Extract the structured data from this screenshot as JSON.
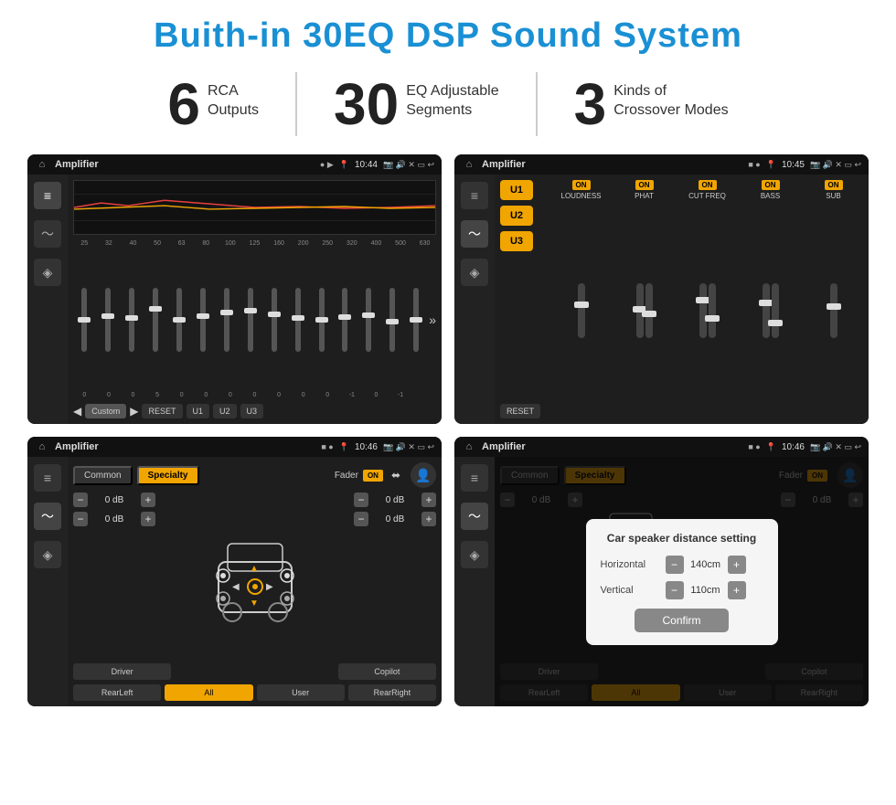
{
  "title": "Buith-in 30EQ DSP Sound System",
  "stats": [
    {
      "number": "6",
      "label": "RCA\nOutputs"
    },
    {
      "number": "30",
      "label": "EQ Adjustable\nSegments"
    },
    {
      "number": "3",
      "label": "Kinds of\nCrossover Modes"
    }
  ],
  "screen1": {
    "status_bar": {
      "home": "⌂",
      "title": "Amplifier",
      "dots": "● ▶",
      "time": "10:44"
    },
    "freq_labels": [
      "25",
      "32",
      "40",
      "50",
      "63",
      "80",
      "100",
      "125",
      "160",
      "200",
      "250",
      "320",
      "400",
      "500",
      "630"
    ],
    "slider_positions": [
      50,
      45,
      48,
      52,
      50,
      45,
      40,
      38,
      42,
      48,
      50,
      47,
      44,
      46,
      44
    ],
    "values": [
      "0",
      "0",
      "0",
      "5",
      "0",
      "0",
      "0",
      "0",
      "0",
      "0",
      "0",
      "-1",
      "0",
      "-1",
      ""
    ],
    "buttons": [
      "Custom",
      "RESET",
      "U1",
      "U2",
      "U3"
    ]
  },
  "screen2": {
    "status_bar": {
      "home": "⌂",
      "title": "Amplifier",
      "dots": "■ ●",
      "time": "10:45"
    },
    "presets": [
      "U1",
      "U2",
      "U3"
    ],
    "controls": [
      {
        "on": true,
        "label": "LOUDNESS"
      },
      {
        "on": true,
        "label": "PHAT"
      },
      {
        "on": true,
        "label": "CUT FREQ"
      },
      {
        "on": true,
        "label": "BASS"
      },
      {
        "on": true,
        "label": "SUB"
      }
    ],
    "reset_btn": "RESET"
  },
  "screen3": {
    "status_bar": {
      "home": "⌂",
      "title": "Amplifier",
      "dots": "■ ●",
      "time": "10:46"
    },
    "tabs": [
      "Common",
      "Specialty"
    ],
    "active_tab": 1,
    "fader_label": "Fader",
    "fader_on": "ON",
    "db_values": [
      "0 dB",
      "0 dB",
      "0 dB",
      "0 dB"
    ],
    "bottom_buttons": [
      "Driver",
      "",
      "Copilot",
      "RearLeft",
      "All",
      "User",
      "RearRight"
    ]
  },
  "screen4": {
    "status_bar": {
      "home": "⌂",
      "title": "Amplifier",
      "dots": "■ ●",
      "time": "10:46"
    },
    "tabs": [
      "Common",
      "Specialty"
    ],
    "active_tab": 1,
    "dialog": {
      "title": "Car speaker distance setting",
      "horizontal_label": "Horizontal",
      "horizontal_value": "140cm",
      "vertical_label": "Vertical",
      "vertical_value": "110cm",
      "confirm_btn": "Confirm"
    },
    "db_values": [
      "0 dB",
      "0 dB"
    ],
    "bottom_buttons": [
      "Driver",
      "Copilot",
      "RearLeft",
      "User",
      "RearRight"
    ]
  }
}
